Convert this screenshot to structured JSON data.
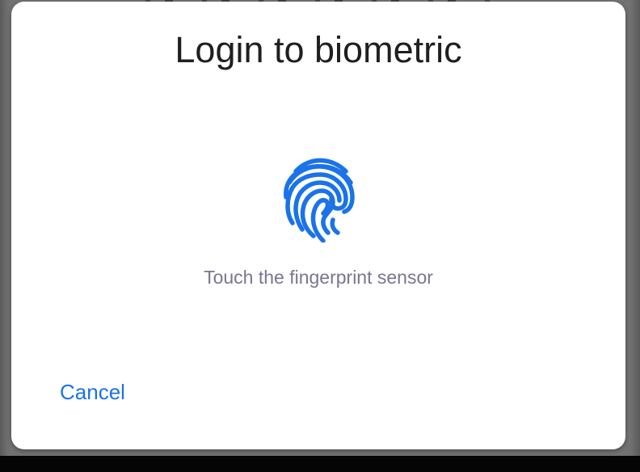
{
  "dialog": {
    "title": "Login to biometric",
    "subtitle": "Touch the fingerprint sensor",
    "cancel_label": "Cancel",
    "icon": "fingerprint-icon"
  },
  "colors": {
    "accent": "#1a73e8",
    "title_text": "#1f1f1f",
    "subtitle_text": "#7a7591",
    "dialog_background": "#ffffff",
    "scrim": "#727272"
  }
}
